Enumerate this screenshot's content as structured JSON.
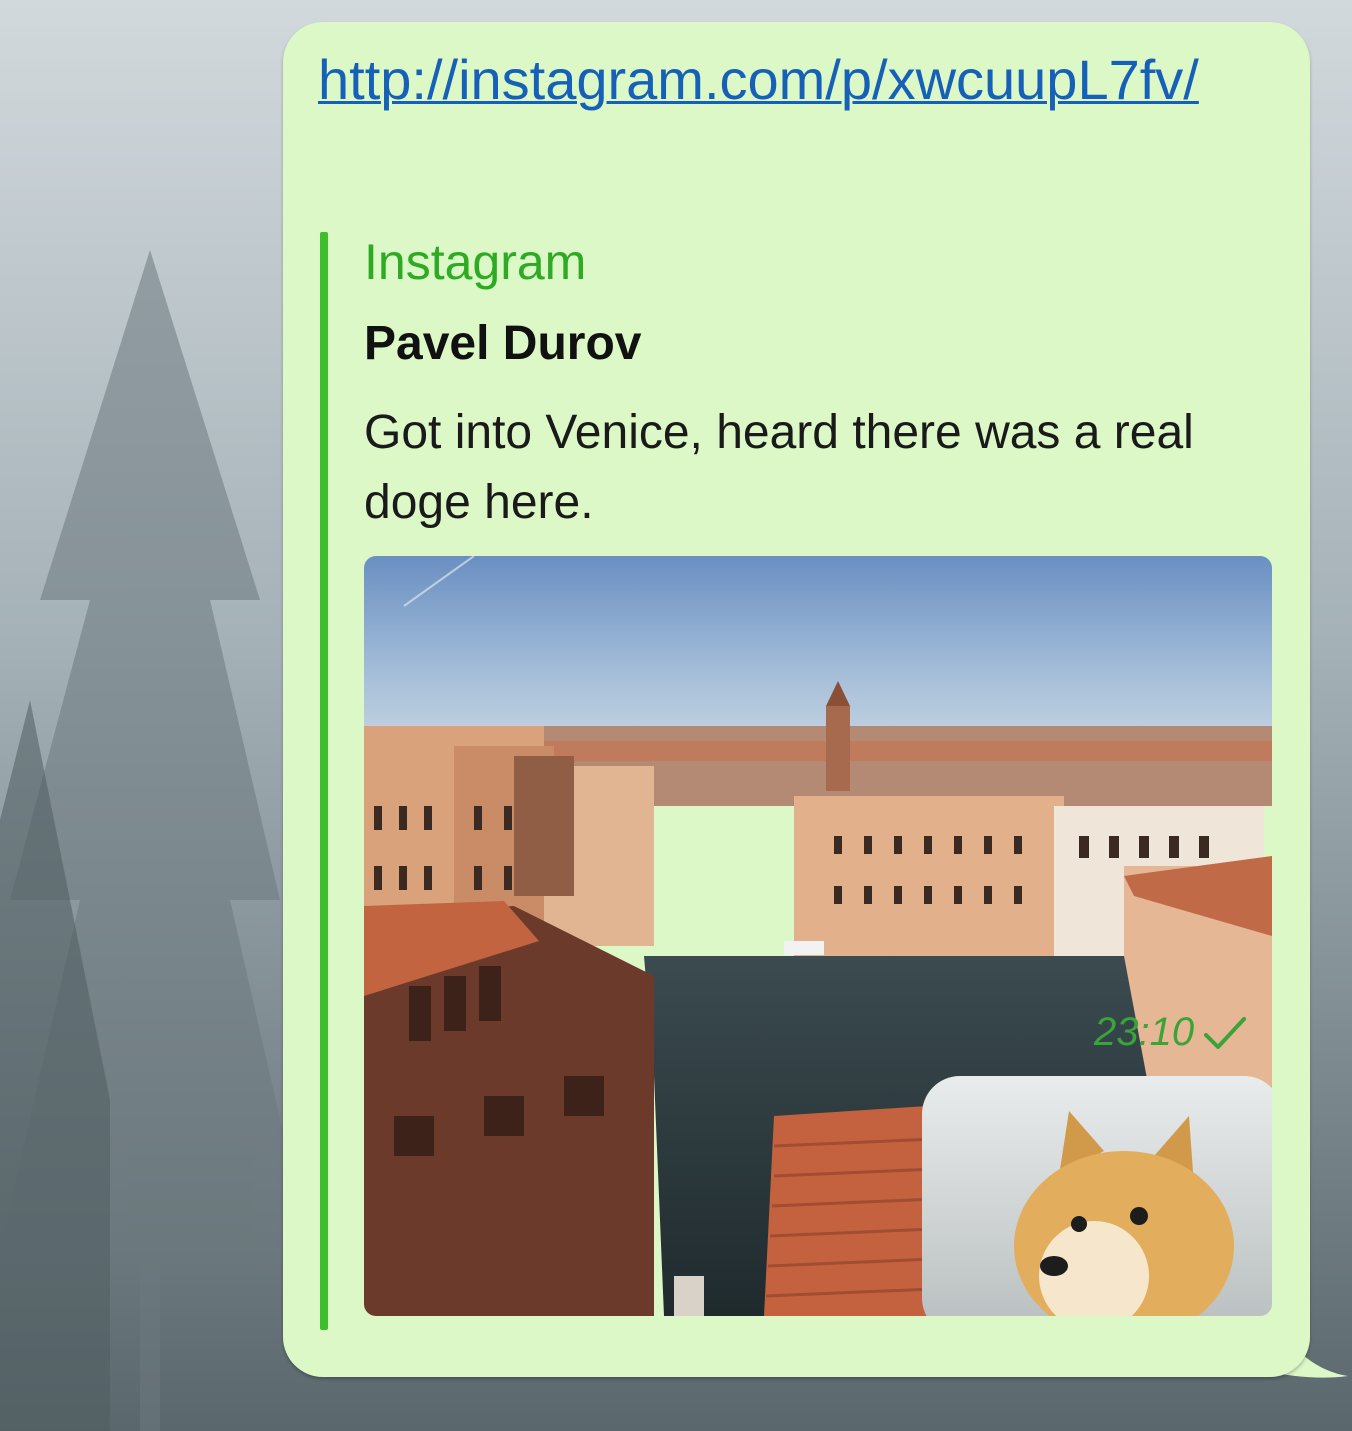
{
  "message": {
    "link_text": "http://instagram.com/p/xwcuupL7fv/",
    "time": "23:10",
    "status_icon": "single-check-icon"
  },
  "preview": {
    "site_name": "Instagram",
    "author": "Pavel Durov",
    "description": "Got into Venice, heard there was a real doge here.",
    "image": "venice-canal-photo-with-doge-sticker"
  },
  "colors": {
    "bubble": "#dcf8c6",
    "link": "#1660b8",
    "accent": "#3fbe2d",
    "time": "#3aa33a"
  }
}
